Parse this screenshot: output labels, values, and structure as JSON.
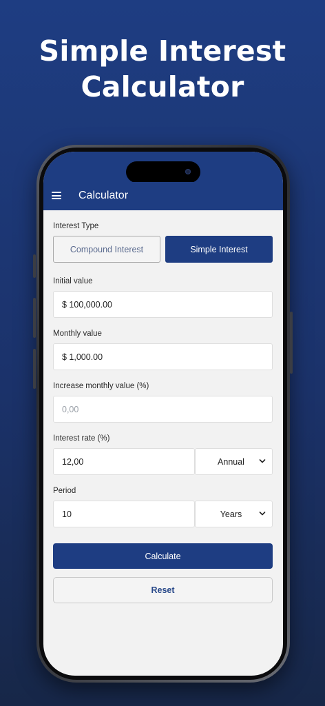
{
  "promo": {
    "title_line1": "Simple Interest",
    "title_line2": "Calculator"
  },
  "app_bar": {
    "menu_icon": "hamburger-menu-icon",
    "title": "Calculator"
  },
  "form": {
    "interest_type": {
      "label": "Interest Type",
      "options": [
        "Compound Interest",
        "Simple Interest"
      ],
      "selected": "Simple Interest"
    },
    "initial_value": {
      "label": "Initial value",
      "value": "$ 100,000.00"
    },
    "monthly_value": {
      "label": "Monthly value",
      "value": "$ 1,000.00"
    },
    "increase_monthly": {
      "label": "Increase monthly value (%)",
      "placeholder": "0,00"
    },
    "interest_rate": {
      "label": "Interest rate (%)",
      "value": "12,00",
      "period_select": "Annual"
    },
    "period": {
      "label": "Period",
      "value": "10",
      "unit_select": "Years"
    }
  },
  "actions": {
    "calculate": "Calculate",
    "reset": "Reset"
  },
  "colors": {
    "brand": "#1e3d82",
    "screen_bg": "#f2f2f2"
  }
}
